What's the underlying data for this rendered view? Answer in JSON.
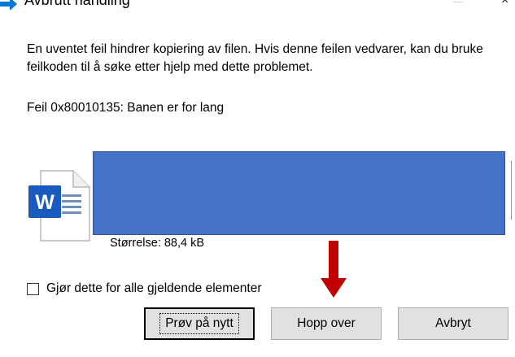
{
  "window": {
    "title": "Avbrutt handling",
    "close_glyph": "×"
  },
  "message": {
    "body": "En uventet feil hindrer kopiering av filen. Hvis denne feilen vedvarer, kan du bruke feilkoden til å søke etter hjelp med dette problemet.",
    "error": "Feil 0x80010135: Banen er for lang"
  },
  "file": {
    "icon": "word-document-icon",
    "icon_letter": "W",
    "size_text": "Størrelse: 88,4 kB",
    "name_redacted_color": "#4472c4"
  },
  "options": {
    "apply_all_label": "Gjør dette for alle gjeldende elementer",
    "apply_all_checked": false
  },
  "annotation": {
    "arrow_color": "#c00000",
    "arrow_direction": "down"
  },
  "buttons": {
    "retry_label": "Prøv på nytt",
    "skip_label": "Hopp over",
    "cancel_label": "Avbryt"
  },
  "colors": {
    "accent": "#0078d7",
    "word_blue": "#185abd",
    "button_face": "#e1e1e1"
  }
}
